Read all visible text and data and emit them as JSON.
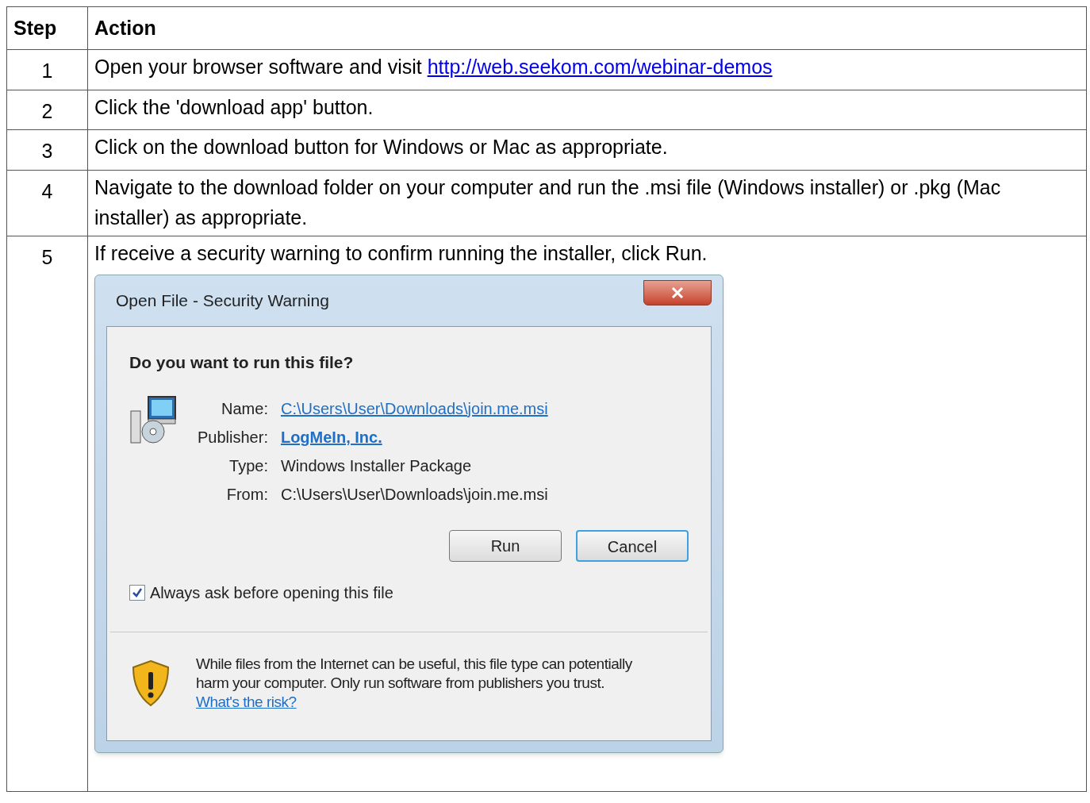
{
  "table": {
    "columns": [
      "Step",
      "Action"
    ],
    "rows": [
      {
        "step": "1",
        "text": "Open your browser software and visit ",
        "link": "http://web.seekom.com/webinar-demos"
      },
      {
        "step": "2",
        "text": "Click the 'download app' button."
      },
      {
        "step": "3",
        "text": "Click on the download button for Windows or Mac as appropriate."
      },
      {
        "step": "4",
        "text": "Navigate to the download folder on your computer and run the .msi file (Windows installer) or .pkg (Mac installer) as appropriate."
      },
      {
        "step": "5",
        "text": "If receive a security warning to confirm running the installer, click Run.",
        "dialog": {
          "title": "Open File - Security Warning",
          "heading": "Do you want to run this file?",
          "fields": [
            {
              "label": "Name:",
              "value": "C:\\Users\\User\\Downloads\\join.me.msi",
              "kind": "link"
            },
            {
              "label": "Publisher:",
              "value": "LogMeIn, Inc.",
              "kind": "bold_link"
            },
            {
              "label": "Type:",
              "value": "Windows Installer Package",
              "kind": "text"
            },
            {
              "label": "From:",
              "value": "C:\\Users\\User\\Downloads\\join.me.msi",
              "kind": "text"
            }
          ],
          "buttons": [
            {
              "label": "Run",
              "focused": false
            },
            {
              "label": "Cancel",
              "focused": true
            }
          ],
          "checkbox": {
            "label": "Always ask before opening this file",
            "checked": true
          },
          "warning": {
            "text": "While files from the Internet can be useful, this file type can potentially harm your computer. Only run software from publishers you trust. ",
            "link": "What's the risk?"
          }
        }
      }
    ]
  }
}
